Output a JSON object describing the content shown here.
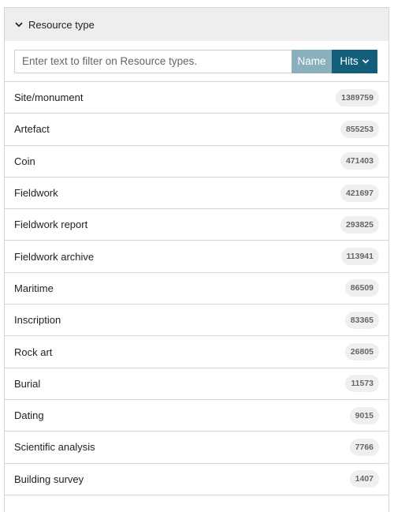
{
  "facet": {
    "title": "Resource type",
    "filter": {
      "placeholder": "Enter text to filter on Resource types.",
      "value": ""
    },
    "sort": {
      "name_label": "Name",
      "hits_label": "Hits"
    },
    "items": [
      {
        "label": "Site/monument",
        "count": "1389759"
      },
      {
        "label": "Artefact",
        "count": "855253"
      },
      {
        "label": "Coin",
        "count": "471403"
      },
      {
        "label": "Fieldwork",
        "count": "421697"
      },
      {
        "label": "Fieldwork report",
        "count": "293825"
      },
      {
        "label": "Fieldwork archive",
        "count": "113941"
      },
      {
        "label": "Maritime",
        "count": "86509"
      },
      {
        "label": "Inscription",
        "count": "83365"
      },
      {
        "label": "Rock art",
        "count": "26805"
      },
      {
        "label": "Burial",
        "count": "11573"
      },
      {
        "label": "Dating",
        "count": "9015"
      },
      {
        "label": "Scientific analysis",
        "count": "7766"
      },
      {
        "label": "Building survey",
        "count": "1407"
      }
    ]
  }
}
